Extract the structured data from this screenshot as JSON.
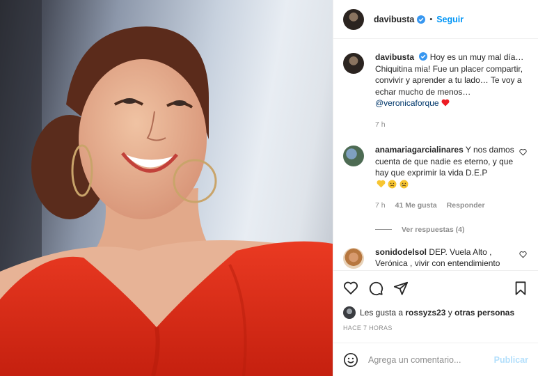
{
  "post": {
    "author": "davibusta",
    "follow_label": "Seguir",
    "dot": "•",
    "caption": {
      "username": "davibusta",
      "text": "Hoy es un muy mal día… Chiquitina mia! Fue un placer compartir, convivir y aprender a tu lado… Te voy a echar mucho de menos…",
      "mention": "@veronicaforque",
      "time": "7 h"
    }
  },
  "comments": [
    {
      "username": "anamariagarcialinares",
      "text": "Y nos damos cuenta de que nadie es eterno, y que hay que exprimir la vida D.E.P",
      "time": "7 h",
      "likes": "41 Me gusta",
      "reply_label": "Responder",
      "view_replies": "Ver respuestas (4)"
    },
    {
      "username": "sonidodelsol",
      "text": "DEP. Vuela Alto , Verónica , vivir con entendimiento"
    }
  ],
  "likes_line": {
    "prefix": "Les gusta a",
    "user": "rossyzs23",
    "middle": "y",
    "others": "otras personas"
  },
  "timestamp": "HACE 7 HORAS",
  "composer": {
    "placeholder": "Agrega un comentario...",
    "publish_label": "Publicar"
  },
  "colors": {
    "link_blue": "#0095f6",
    "publish_disabled": "#b2dffc",
    "heart_red": "#ed1c24",
    "muted": "#8e8e8e"
  },
  "icons": [
    "heart-icon",
    "comment-icon",
    "share-icon",
    "save-icon",
    "emoji-icon",
    "verified-icon",
    "more-icon"
  ]
}
